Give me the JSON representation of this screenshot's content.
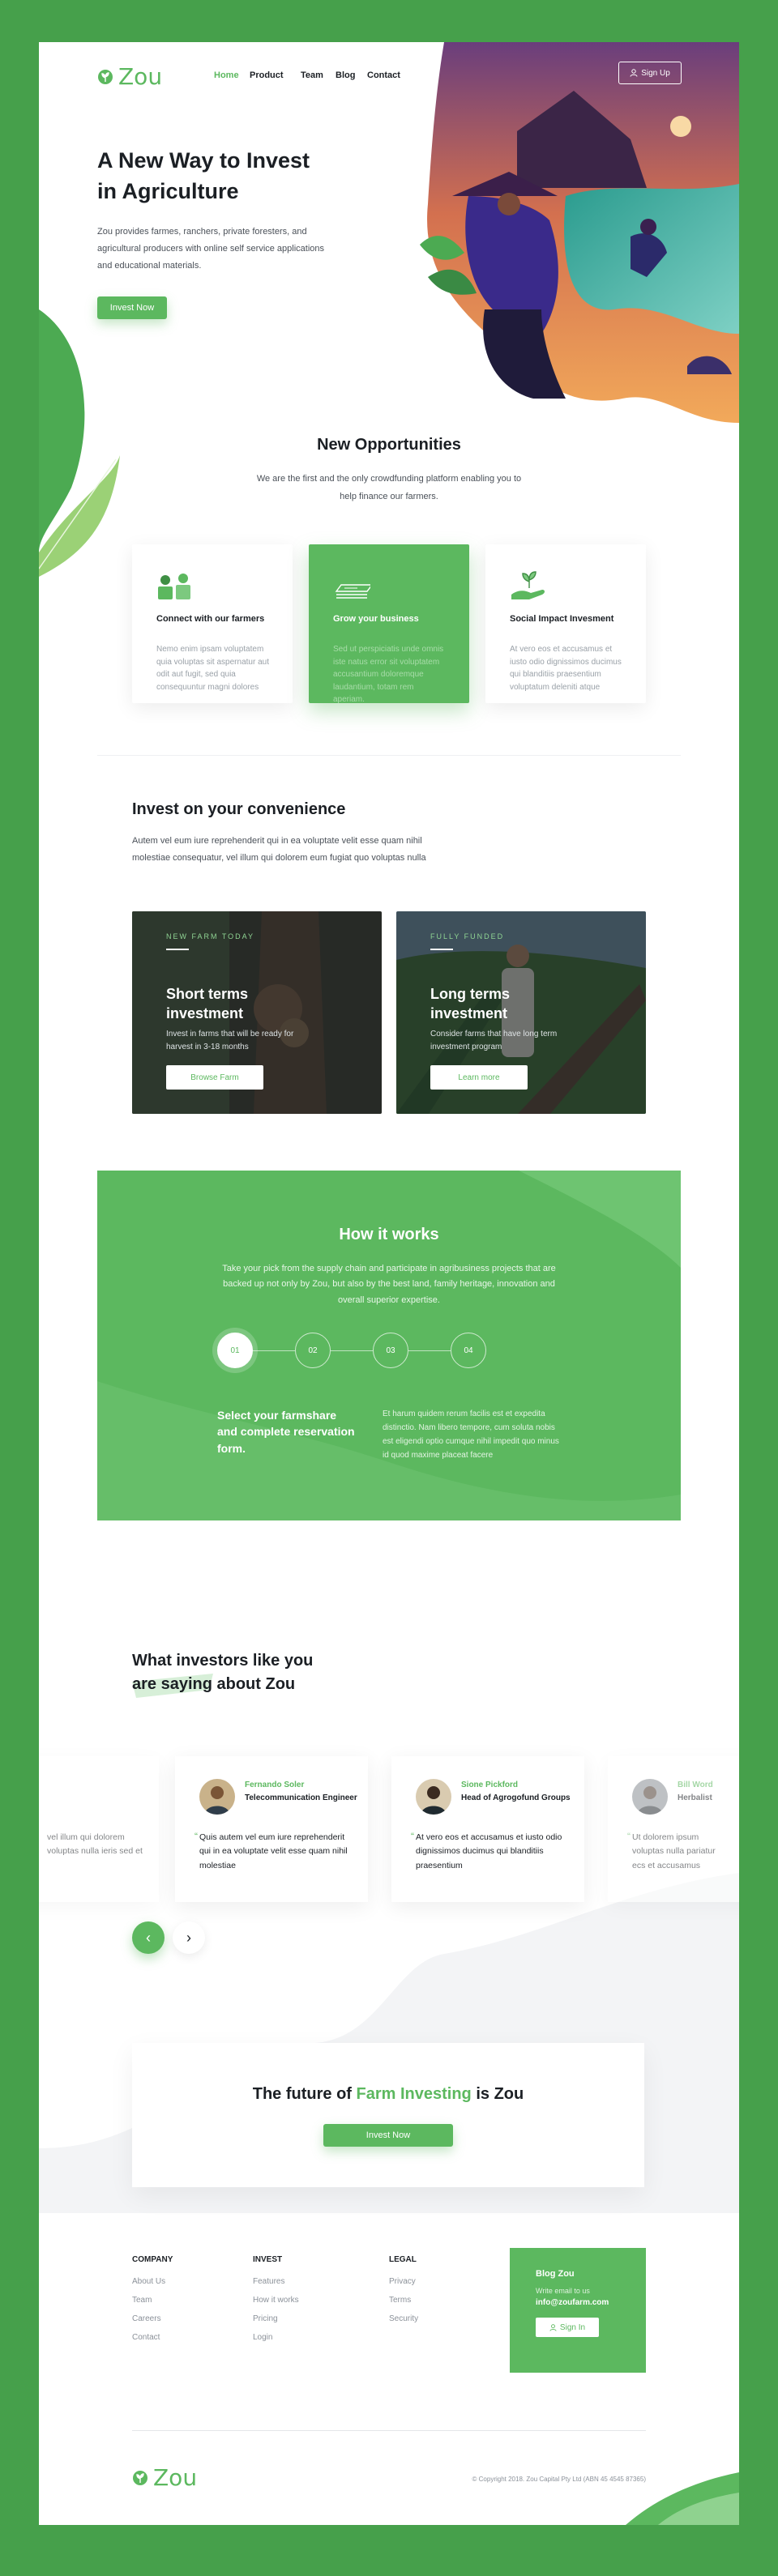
{
  "brand": {
    "name": "Zou",
    "accent": "#5cb85f",
    "frame": "#46a04b"
  },
  "nav": {
    "items": [
      "Home",
      "Product",
      "Team",
      "Blog",
      "Contact"
    ],
    "active": "Home",
    "signup": "Sign Up"
  },
  "hero": {
    "title_line1": "A New Way to Invest",
    "title_line2": "in Agriculture",
    "desc": "Zou provides farmes, ranchers, private foresters, and agricultural producers with online self service applications and educational materials.",
    "cta": "Invest Now"
  },
  "opportunities": {
    "title": "New Opportunities",
    "sub": "We are the first and the only crowdfunding platform enabling you to help finance our farmers.",
    "cards": [
      {
        "icon": "farmers-icon",
        "title": "Connect with our farmers",
        "desc": "Nemo enim ipsam voluptatem quia voluptas sit aspernatur aut odit aut fugit, sed quia consequuntur magni dolores"
      },
      {
        "icon": "money-stack-icon",
        "title": "Grow your business",
        "desc": "Sed ut perspiciatis unde omnis iste natus error sit voluptatem accusantium doloremque laudantium, totam rem aperiam."
      },
      {
        "icon": "plant-hand-icon",
        "title": "Social Impact Invesment",
        "desc": "At vero eos et accusamus et iusto odio dignissimos ducimus qui blanditiis praesentium voluptatum deleniti atque"
      }
    ]
  },
  "invest": {
    "title": "Invest on your convenience",
    "desc": "Autem vel eum iure reprehenderit qui in ea voluptate velit esse quam nihil molestiae consequatur, vel illum qui dolorem eum fugiat quo voluptas nulla",
    "cards": [
      {
        "tag": "NEW FARM TODAY",
        "title": "Short terms investment",
        "desc": "Invest in farms that will be ready for harvest in 3-18 months",
        "button": "Browse Farm"
      },
      {
        "tag": "FULLY FUNDED",
        "title": "Long terms investment",
        "desc": "Consider farms that have long term investment program",
        "button": "Learn more"
      }
    ]
  },
  "how": {
    "title": "How it works",
    "desc": "Take your pick from the supply chain and participate in agribusiness projects that are backed up not only by Zou, but also by the best land, family heritage, innovation and overall superior expertise.",
    "steps": [
      "01",
      "02",
      "03",
      "04"
    ],
    "active_step": "01",
    "step_title": "Select your farmshare and complete reservation form.",
    "step_desc": "Et harum quidem rerum facilis est et expedita distinctio. Nam libero tempore, cum soluta nobis est eligendi optio cumque nihil impedit quo minus id quod maxime placeat facere"
  },
  "testimonials": {
    "title_line1": "What investors like you",
    "title_line2": "are saying about Zou",
    "items": [
      {
        "name": "",
        "role": "",
        "quote": "vel illum qui dolorem voluptas nulla ieris sed et"
      },
      {
        "name": "Fernando Soler",
        "role": "Telecommunication Engineer",
        "quote": "Quis autem vel eum iure reprehenderit qui in ea voluptate velit esse quam nihil molestiae"
      },
      {
        "name": "Sione Pickford",
        "role": "Head of Agrogofund Groups",
        "quote": "At vero eos et accusamus et iusto odio dignissimos ducimus qui blanditiis praesentium"
      },
      {
        "name": "Bill Word",
        "role": "Herbalist",
        "quote": "Ut dolorem ipsum voluptas nulla pariatur ecs et accusamus"
      }
    ],
    "prev": "‹",
    "next": "›"
  },
  "cta": {
    "title_pre": "The future of ",
    "title_green": "Farm Investing",
    "title_post": " is Zou",
    "button": "Invest Now"
  },
  "footer": {
    "company": {
      "title": "COMPANY",
      "links": [
        "About Us",
        "Team",
        "Careers",
        "Contact"
      ]
    },
    "invest": {
      "title": "INVEST",
      "links": [
        "Features",
        "How it works",
        "Pricing",
        "Login"
      ]
    },
    "legal": {
      "title": "LEGAL",
      "links": [
        "Privacy",
        "Terms",
        "Security"
      ]
    },
    "blog": {
      "title": "Blog Zou",
      "label": "Write email to us",
      "email": "info@zoufarm.com",
      "button": "Sign In"
    },
    "copyright": "© Copyright 2018. Zou Capital Pty Ltd (ABN 45 4545 87365)"
  }
}
